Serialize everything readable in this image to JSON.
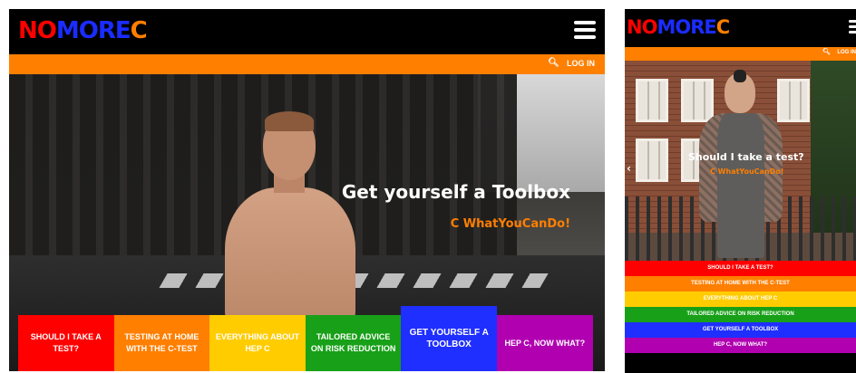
{
  "brand": {
    "logo_letters": [
      {
        "ch": "N",
        "color": "#ff0000"
      },
      {
        "ch": "O",
        "color": "#ff0000"
      },
      {
        "ch": "M",
        "color": "#1a2cff"
      },
      {
        "ch": "O",
        "color": "#1a2cff"
      },
      {
        "ch": "R",
        "color": "#1a2cff"
      },
      {
        "ch": "E",
        "color": "#1a2cff"
      },
      {
        "ch": "C",
        "color": "#ff7f00"
      }
    ],
    "accent": "#ff7f00"
  },
  "header": {
    "menu_icon": "hamburger-icon",
    "search_icon": "search-icon",
    "login_label": "LOG IN"
  },
  "desktop": {
    "hero": {
      "title": "Get yourself a Toolbox",
      "subtitle": "C WhatYouCanDo!"
    },
    "tiles": [
      {
        "label": "SHOULD I TAKE A TEST?",
        "color": "#ff0000"
      },
      {
        "label": "TESTING AT HOME WITH THE C-TEST",
        "color": "#ff7f00"
      },
      {
        "label": "EVERYTHING ABOUT HEP C",
        "color": "#ffcc00"
      },
      {
        "label": "TAILORED ADVICE ON RISK REDUCTION",
        "color": "#18a018"
      },
      {
        "label": "GET YOURSELF A TOOLBOX",
        "color": "#1f2fff"
      },
      {
        "label": "HEP C, NOW WHAT?",
        "color": "#b000b0"
      }
    ]
  },
  "mobile": {
    "hero": {
      "title": "Should I take a test?",
      "subtitle": "C WhatYouCanDo!",
      "prev_arrow": "‹"
    },
    "nav": [
      {
        "label": "SHOULD I TAKE A TEST?",
        "color": "#ff0000"
      },
      {
        "label": "TESTING AT HOME WITH THE C-TEST",
        "color": "#ff7f00"
      },
      {
        "label": "EVERYTHING ABOUT HEP C",
        "color": "#ffcc00"
      },
      {
        "label": "TAILORED ADVICE ON RISK REDUCTION",
        "color": "#18a018"
      },
      {
        "label": "GET YOURSELF A TOOLBOX",
        "color": "#1f2fff"
      },
      {
        "label": "HEP C, NOW WHAT?",
        "color": "#b000b0"
      }
    ]
  }
}
